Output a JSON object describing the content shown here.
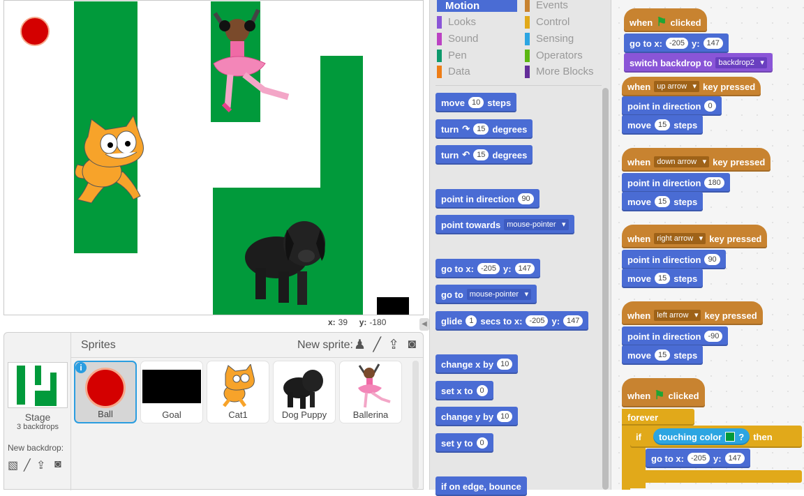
{
  "coords": {
    "x_label": "x:",
    "x": "39",
    "y_label": "y:",
    "y": "-180"
  },
  "sprites_panel": {
    "title": "Sprites",
    "new_sprite_label": "New sprite:"
  },
  "stage_info": {
    "name": "Stage",
    "count": "3 backdrops",
    "new_backdrop": "New backdrop:"
  },
  "sprites": [
    {
      "name": "Ball"
    },
    {
      "name": "Goal"
    },
    {
      "name": "Cat1"
    },
    {
      "name": "Dog Puppy"
    },
    {
      "name": "Ballerina"
    }
  ],
  "categories": [
    "Motion",
    "Events",
    "Looks",
    "Control",
    "Sound",
    "Sensing",
    "Pen",
    "Operators",
    "Data",
    "More Blocks"
  ],
  "palette": {
    "move": [
      "move",
      "10",
      "steps"
    ],
    "turn_right": [
      "turn",
      "15",
      "degrees"
    ],
    "turn_left": [
      "turn",
      "15",
      "degrees"
    ],
    "point_dir": [
      "point in direction",
      "90"
    ],
    "point_towards": [
      "point towards",
      "mouse-pointer"
    ],
    "goto_xy": [
      "go to x:",
      "-205",
      "y:",
      "147"
    ],
    "goto": [
      "go to",
      "mouse-pointer"
    ],
    "glide": [
      "glide",
      "1",
      "secs to x:",
      "-205",
      "y:",
      "147"
    ],
    "change_x": [
      "change x by",
      "10"
    ],
    "set_x": [
      "set x to",
      "0"
    ],
    "change_y": [
      "change y by",
      "10"
    ],
    "set_y": [
      "set y to",
      "0"
    ],
    "bounce": "if on edge, bounce"
  },
  "scripts": {
    "s1": {
      "hat": [
        "when",
        "clicked"
      ],
      "goto": [
        "go to x:",
        "-205",
        "y:",
        "147"
      ],
      "backdrop": [
        "switch backdrop to",
        "backdrop2"
      ]
    },
    "up": {
      "hat": [
        "when",
        "up arrow",
        "key pressed"
      ],
      "point": [
        "point in direction",
        "0"
      ],
      "move": [
        "move",
        "15",
        "steps"
      ]
    },
    "down": {
      "hat": [
        "when",
        "down arrow",
        "key pressed"
      ],
      "point": [
        "point in direction",
        "180"
      ],
      "move": [
        "move",
        "15",
        "steps"
      ]
    },
    "right": {
      "hat": [
        "when",
        "right arrow",
        "key pressed"
      ],
      "point": [
        "point in direction",
        "90"
      ],
      "move": [
        "move",
        "15",
        "steps"
      ]
    },
    "left": {
      "hat": [
        "when",
        "left arrow",
        "key pressed"
      ],
      "point": [
        "point in direction",
        "-90"
      ],
      "move": [
        "move",
        "15",
        "steps"
      ]
    },
    "s6": {
      "hat": [
        "when",
        "clicked"
      ],
      "forever": "forever",
      "if": "if",
      "touching": "touching color",
      "q": "?",
      "then": "then",
      "goto": [
        "go to x:",
        "-205",
        "y:",
        "147"
      ]
    }
  }
}
